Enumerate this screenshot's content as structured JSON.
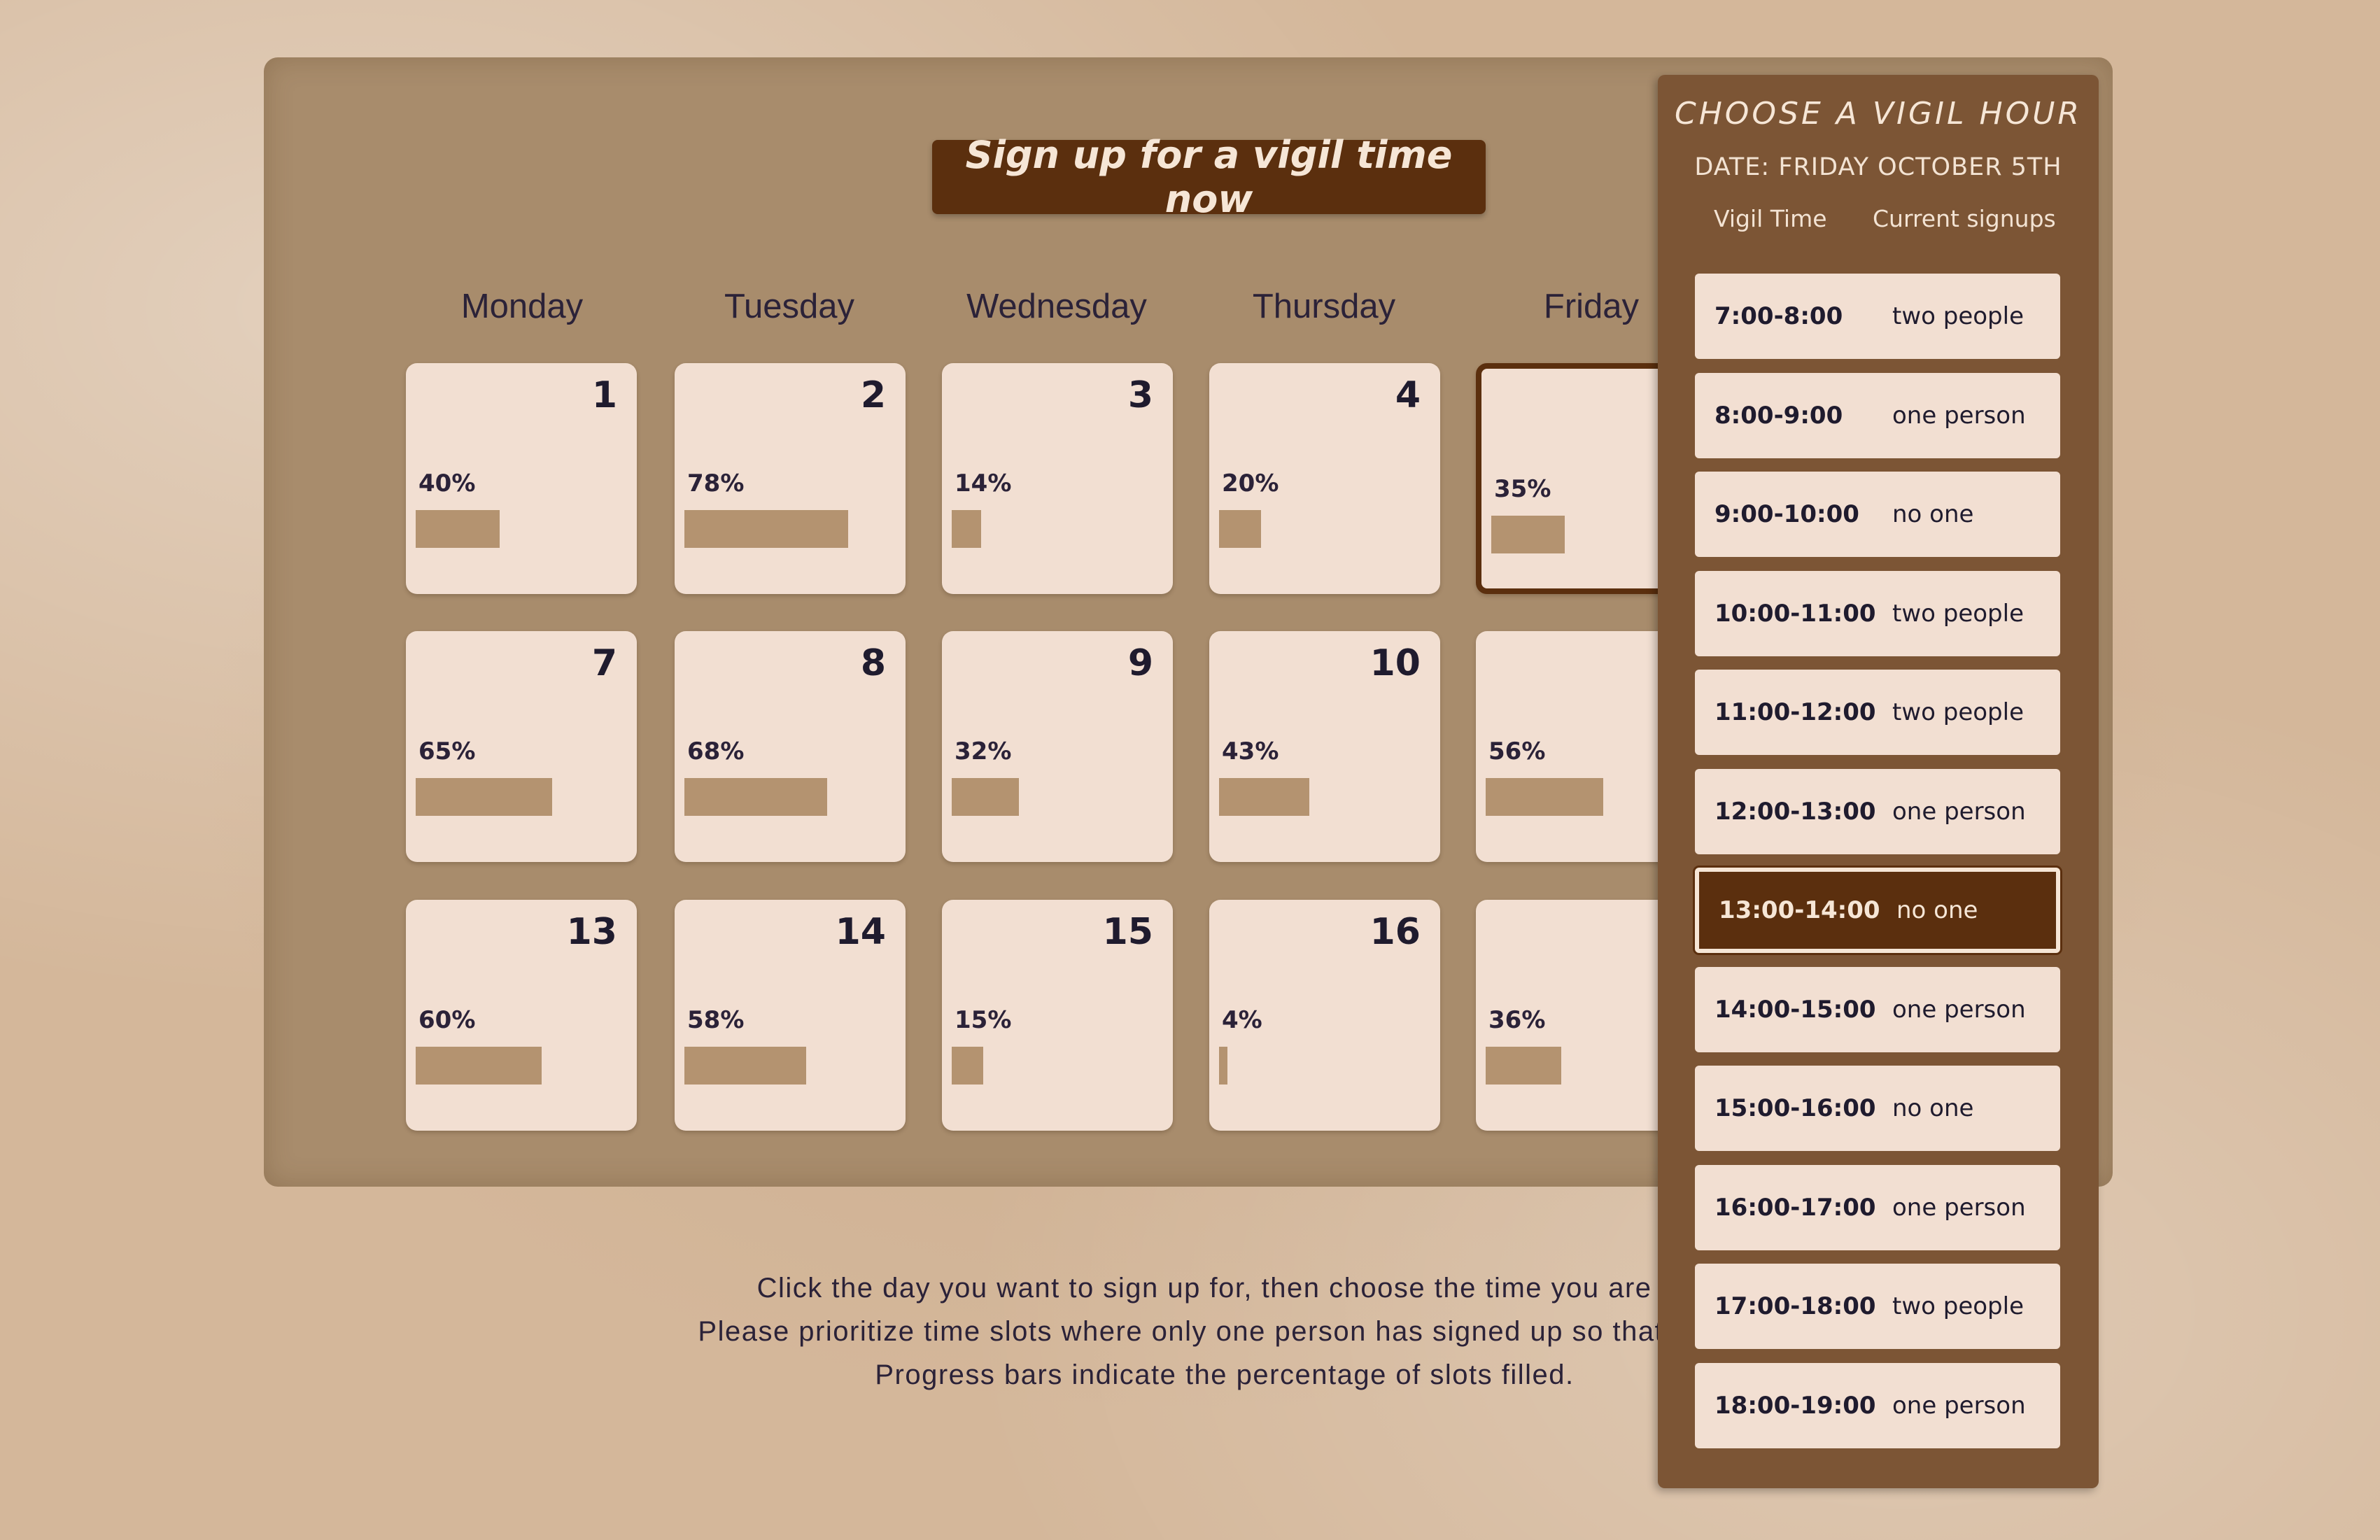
{
  "signup_button": "Sign up for a vigil time now",
  "days": [
    "Monday",
    "Tuesday",
    "Wednesday",
    "Thursday",
    "Friday"
  ],
  "calendar": [
    {
      "day": "1",
      "percent": "40%",
      "fill": 0.4
    },
    {
      "day": "2",
      "percent": "78%",
      "fill": 0.78
    },
    {
      "day": "3",
      "percent": "14%",
      "fill": 0.14
    },
    {
      "day": "4",
      "percent": "20%",
      "fill": 0.2
    },
    {
      "day": "",
      "percent": "35%",
      "fill": 0.35,
      "selected": true
    },
    {
      "day": "7",
      "percent": "65%",
      "fill": 0.65
    },
    {
      "day": "8",
      "percent": "68%",
      "fill": 0.68
    },
    {
      "day": "9",
      "percent": "32%",
      "fill": 0.32
    },
    {
      "day": "10",
      "percent": "43%",
      "fill": 0.43
    },
    {
      "day": "",
      "percent": "56%",
      "fill": 0.56
    },
    {
      "day": "13",
      "percent": "60%",
      "fill": 0.6
    },
    {
      "day": "14",
      "percent": "58%",
      "fill": 0.58
    },
    {
      "day": "15",
      "percent": "15%",
      "fill": 0.15
    },
    {
      "day": "16",
      "percent": "4%",
      "fill": 0.04
    },
    {
      "day": "",
      "percent": "36%",
      "fill": 0.36
    }
  ],
  "instructions": [
    "Click the day you want to sign up for, then choose the time you are av",
    "Please prioritize time slots where only one person has signed up so that vigil g",
    "Progress bars indicate the percentage of slots filled."
  ],
  "panel": {
    "title": "CHOOSE A VIGIL HOUR",
    "date": "DATE: FRIDAY OCTOBER 5TH",
    "col_time": "Vigil Time",
    "col_signups": "Current signups",
    "slots": [
      {
        "time": "7:00-8:00",
        "signups": "two people"
      },
      {
        "time": "8:00-9:00",
        "signups": "one person"
      },
      {
        "time": "9:00-10:00",
        "signups": "no one"
      },
      {
        "time": "10:00-11:00",
        "signups": "two people"
      },
      {
        "time": "11:00-12:00",
        "signups": "two people"
      },
      {
        "time": "12:00-13:00",
        "signups": "one person"
      },
      {
        "time": "13:00-14:00",
        "signups": "no one",
        "active": true
      },
      {
        "time": "14:00-15:00",
        "signups": "one person"
      },
      {
        "time": "15:00-16:00",
        "signups": "no one"
      },
      {
        "time": "16:00-17:00",
        "signups": "one person"
      },
      {
        "time": "17:00-18:00",
        "signups": "two people"
      },
      {
        "time": "18:00-19:00",
        "signups": "one person"
      }
    ]
  },
  "colors": {
    "accent": "#5b2f0e",
    "panel": "#7c5535",
    "cell": "#f2dfd2",
    "bar": "#b49370"
  }
}
